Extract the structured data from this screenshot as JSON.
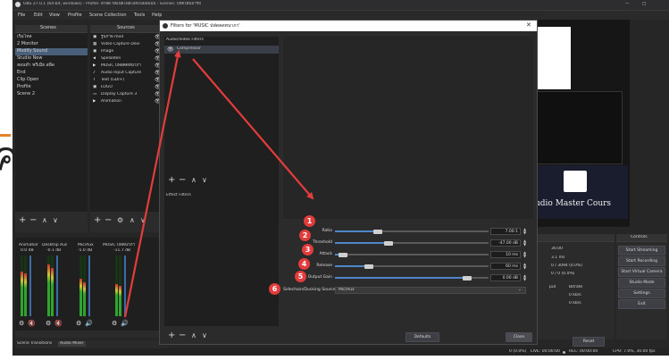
{
  "window": {
    "title": "OBS 27.0.1 (64-bit, windows) - Profile: สำลัด กดเปิดไฟล์ไลฟ์ไปมิลแบบ - Scenes: ปกติใหม่มารถ",
    "menu": [
      "File",
      "Edit",
      "View",
      "Profile",
      "Scene Collection",
      "Tools",
      "Help"
    ]
  },
  "background_letter": "ค",
  "scenes": {
    "header": "Scenes",
    "items": [
      "เริ่มไหล",
      "2 Monitor",
      "Modify Sound",
      "Studio New",
      "สอนทำ พรีเมีย สลีด",
      "End",
      "Clip Open",
      "Profile",
      "Scene 2"
    ],
    "selected_index": 2
  },
  "sources": {
    "header": "Sources",
    "items": [
      {
        "icon": "image-icon",
        "label": "รูปภาพ mod"
      },
      {
        "icon": "camera-icon",
        "label": "Video Capture Devi"
      },
      {
        "icon": "image-icon",
        "label": "Image"
      },
      {
        "icon": "speaker-icon",
        "label": "Spelalden"
      },
      {
        "icon": "play-icon",
        "label": "MUSIC ปฟดคดทนาภา"
      },
      {
        "icon": "mic-icon",
        "label": "Audio Input Capture"
      },
      {
        "icon": "text-icon",
        "label": "Text (GDI+)"
      },
      {
        "icon": "image-icon",
        "label": "LOGO"
      },
      {
        "icon": "monitor-icon",
        "label": "Display Capture 3"
      },
      {
        "icon": "play-icon",
        "label": "Animation"
      }
    ]
  },
  "mixer": {
    "channels": [
      {
        "name": "Animation",
        "db": "0.0 dB"
      },
      {
        "name": "Desktop Audio",
        "db": "-0.1 dB"
      },
      {
        "name": "Mic/Aux",
        "db": "-5.0 dB"
      },
      {
        "name": "MUSIC ปฟดนาภา",
        "db": "-11.7 dB"
      }
    ],
    "tabs": [
      "Scene Transitions",
      "Audio Mixer"
    ]
  },
  "filters_dialog": {
    "title": "Filters for 'MUSIC ปฟดคดทนาภา'",
    "audio_video_header": "Audio/Video Filters",
    "effect_header": "Effect Filters",
    "filters": [
      "Compressor"
    ],
    "params": [
      {
        "label": "Ratio",
        "value": "7.00:1",
        "fraction": 0.28
      },
      {
        "label": "Threshold",
        "value": "-47.00 dB",
        "fraction": 0.35
      },
      {
        "label": "Attack",
        "value": "10 ms",
        "fraction": 0.05
      },
      {
        "label": "Release",
        "value": "60 ms",
        "fraction": 0.22
      },
      {
        "label": "Output Gain",
        "value": "0.00 dB",
        "fraction": 0.86
      }
    ],
    "sidechain_label": "Sidechain/Ducking Source",
    "sidechain_value": "Mic/Aux",
    "defaults_label": "Defaults",
    "close_label": "Close"
  },
  "annotations": [
    "1",
    "2",
    "3",
    "4",
    "5",
    "6"
  ],
  "preview_text": "udio Master Cours",
  "stats": {
    "rows": [
      "30.00",
      "3.1 ms",
      "0 / 3094 (0.0%)",
      "0 / 0 (0.0%)"
    ],
    "col1": "put",
    "col2": "Bitrate",
    "kbps1": "0 kb/s",
    "kbps2": "0 kb/s",
    "reset": "Reset"
  },
  "controls": {
    "header": "Controls",
    "buttons": [
      "Start Streaming",
      "Start Recording",
      "Start Virtual Camera",
      "Studio Mode",
      "Settings",
      "Exit"
    ]
  },
  "statusbar": {
    "live": "LIVE: 00:00:00",
    "rec": "REC: 00:00:00",
    "cpu": "CPU: 7.0%, 30.00 fps",
    "drop": "0 (0.0%)"
  },
  "colors": {
    "accent_red": "#e23c3c",
    "obs_dark": "#2b2b2b",
    "slider_blue": "#4e86c9"
  }
}
